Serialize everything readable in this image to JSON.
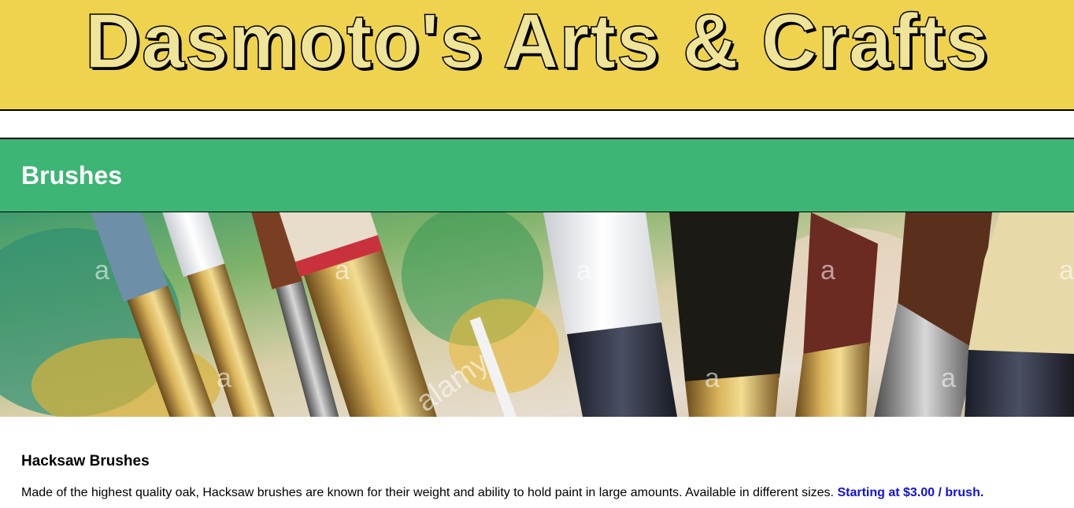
{
  "header": {
    "site_title": "Dasmoto's Arts & Crafts",
    "background_color": "#efd34f",
    "title_color": "#efe497"
  },
  "section": {
    "title": "Brushes",
    "background_color": "#3db574"
  },
  "banner": {
    "image_alt": "paint brushes photo",
    "watermark": "alamy",
    "watermark_small": "a"
  },
  "product": {
    "title": "Hacksaw Brushes",
    "description": "Made of the highest quality oak, Hacksaw brushes are known for their weight and ability to hold paint in large amounts. Available in different sizes.",
    "price": "Starting at $3.00 / brush.",
    "price_color": "#1111dd"
  }
}
